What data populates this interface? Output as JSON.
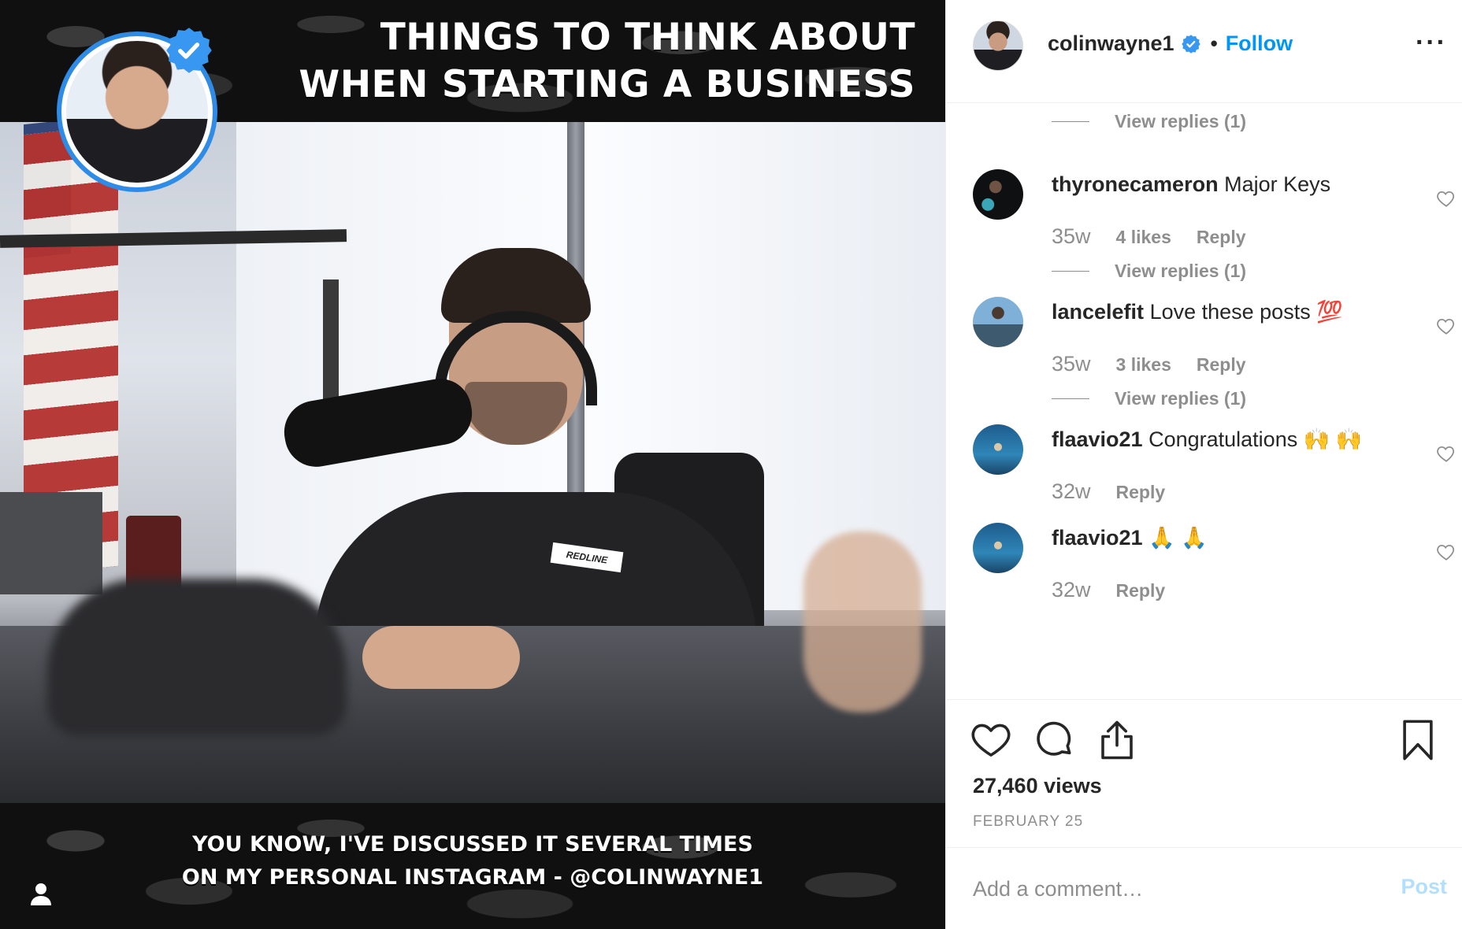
{
  "media": {
    "caption_top_line1": "THINGS TO THINK ABOUT",
    "caption_top_line2": "WHEN STARTING A BUSINESS",
    "caption_bottom_line1": "YOU KNOW, I'VE DISCUSSED IT SEVERAL TIMES",
    "caption_bottom_line2": "ON MY PERSONAL INSTAGRAM - @COLINWAYNE1",
    "shirt_logo": "REDLINE",
    "badge_icon": "verified-check-icon",
    "user_tag_icon": "user-tag-icon"
  },
  "header": {
    "username": "colinwayne1",
    "separator": "•",
    "follow_label": "Follow",
    "more_label": "···"
  },
  "comments": {
    "view_replies_top": "View replies (1)",
    "items": [
      {
        "user": "thyronecameron",
        "text": "Major Keys",
        "time": "35w",
        "likes": "4 likes",
        "reply": "Reply",
        "view_replies": "View replies (1)"
      },
      {
        "user": "lancelefit",
        "text": "Love these posts 💯",
        "time": "35w",
        "likes": "3 likes",
        "reply": "Reply",
        "view_replies": "View replies (1)"
      },
      {
        "user": "flaavio21",
        "text": "Congratulations 🙌 🙌",
        "time": "32w",
        "reply": "Reply"
      },
      {
        "user": "flaavio21",
        "text": "🙏 🙏",
        "time": "32w",
        "reply": "Reply"
      }
    ]
  },
  "actions": {
    "views": "27,460 views",
    "date": "FEBRUARY 25"
  },
  "comment_box": {
    "placeholder": "Add a comment…",
    "post_label": "Post"
  },
  "colors": {
    "accent": "#0095f6",
    "verified": "#3897f0",
    "muted": "#8e8e8e",
    "post_disabled": "#b2dffc"
  }
}
